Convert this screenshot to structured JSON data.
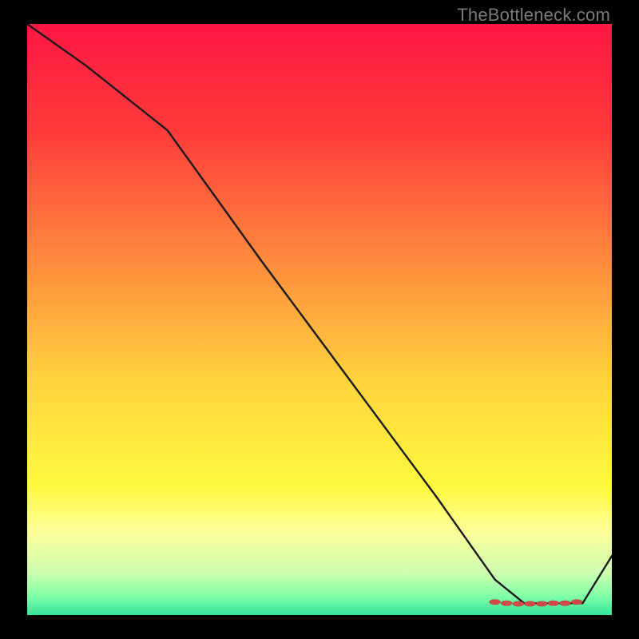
{
  "watermark": "TheBottleneck.com",
  "chart_data": {
    "type": "line",
    "title": "",
    "xlabel": "",
    "ylabel": "",
    "xlim": [
      0,
      100
    ],
    "ylim": [
      0,
      100
    ],
    "gradient_stops": [
      {
        "offset": 0,
        "color": "#ff1744"
      },
      {
        "offset": 0.18,
        "color": "#ff3b3b"
      },
      {
        "offset": 0.4,
        "color": "#ff8a3d"
      },
      {
        "offset": 0.6,
        "color": "#ffd23d"
      },
      {
        "offset": 0.78,
        "color": "#fff93d"
      },
      {
        "offset": 0.86,
        "color": "#fdff9a"
      },
      {
        "offset": 0.93,
        "color": "#ccffb0"
      },
      {
        "offset": 0.97,
        "color": "#7dffa8"
      },
      {
        "offset": 1.0,
        "color": "#34e39a"
      }
    ],
    "series": [
      {
        "name": "bottleneck-curve",
        "x": [
          0,
          10,
          24,
          40,
          55,
          70,
          80,
          85,
          90,
          95,
          100
        ],
        "y": [
          100,
          93,
          82,
          60,
          40,
          20,
          6,
          2,
          2,
          2,
          10
        ]
      }
    ],
    "markers": {
      "name": "optimal-zone",
      "x": [
        80,
        82,
        84,
        86,
        88,
        90,
        92,
        94
      ],
      "y": [
        2.2,
        2.0,
        1.9,
        1.9,
        1.9,
        2.0,
        2.0,
        2.2
      ]
    }
  }
}
